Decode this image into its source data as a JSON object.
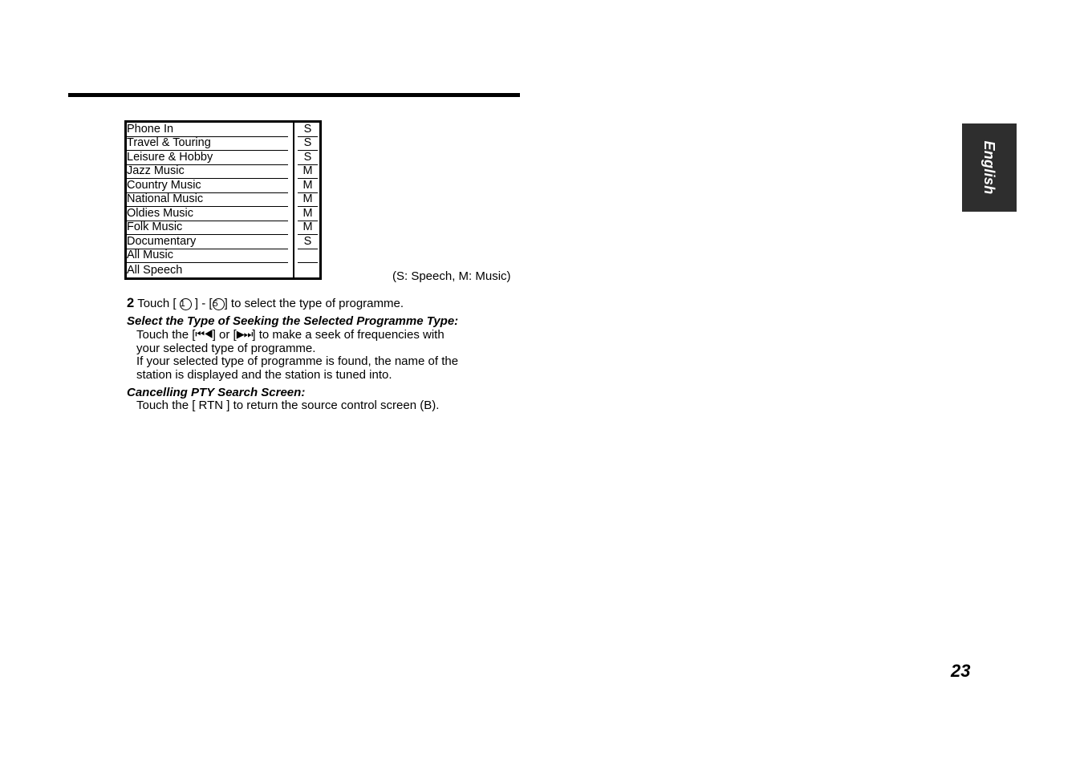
{
  "page": {
    "number": "23",
    "side_tab_label": "English"
  },
  "pty_table": {
    "rows": [
      {
        "name": "Phone In",
        "kind": "S"
      },
      {
        "name": "Travel & Touring",
        "kind": "S"
      },
      {
        "name": "Leisure & Hobby",
        "kind": "S"
      },
      {
        "name": "Jazz Music",
        "kind": "M"
      },
      {
        "name": "Country Music",
        "kind": "M"
      },
      {
        "name": "National Music",
        "kind": "M"
      },
      {
        "name": "Oldies Music",
        "kind": "M"
      },
      {
        "name": "Folk Music",
        "kind": "M"
      },
      {
        "name": "Documentary",
        "kind": "S"
      },
      {
        "name": "All Music",
        "kind": ""
      },
      {
        "name": "All Speech",
        "kind": ""
      }
    ],
    "legend": "(S: Speech, M: Music)"
  },
  "instructions": {
    "step2": {
      "number": "2",
      "text_before": "Touch [",
      "circled_first": "1",
      "text_middle_a": "] - [",
      "circled_second": "5",
      "text_after": "] to select the type of programme."
    },
    "section1": {
      "heading": "Select the Type of Seeking the Selected Programme Type:",
      "line1_a": "Touch the  [",
      "glyph_prev": "⏮◀",
      "line1_b": "]  or [",
      "glyph_next": "▶⏭",
      "line1_c": "] to make a seek of frequencies with",
      "line2": "your selected type of programme.",
      "line3": "If your selected type of programme is found, the name of the",
      "line4": "station is displayed and the station is tuned into."
    },
    "section2": {
      "heading": "Cancelling PTY Search Screen:",
      "line1": "Touch the  [ RTN ] to return the source control screen (B)."
    }
  }
}
